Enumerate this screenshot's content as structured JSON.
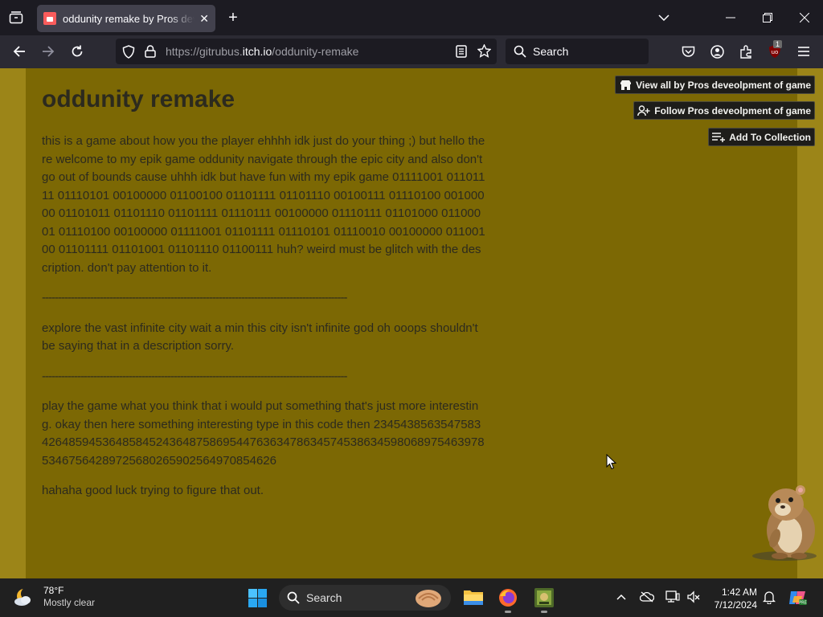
{
  "browser": {
    "tab_title": "oddunity remake by Pros deveolpment of game",
    "url_prefix": "https://gitrubus.",
    "url_domain": "itch.io",
    "url_path": "/oddunity-remake",
    "search_placeholder": "Search",
    "extension_badge": "1"
  },
  "page": {
    "title": "oddunity remake",
    "paragraphs": [
      "this is a game about how you the player ehhhh idk just do your thing ;) but hello there welcome to my epik game oddunity navigate through the epic city and also don't go out of bounds cause uhhh idk but have fun with my epik game 01111001 01101111 01110101 00100000 01100100 01101111 01101110 00100111 01110100 00100000 01101011 01101110 01101111 01110111 00100000 01110111 01101000 01100001 01110100 00100000 01111001 01101111 01110101 01110010 00100000 01100100 01101111 01101001 01101110 01100111 huh? weird must be glitch with the description. don't pay attention to it.",
      "-----------------------------------------------------------------------------------------------",
      "explore the vast infinite city wait a min this city isn't infinite god oh ooops shouldn't be saying that in a description sorry.",
      "-----------------------------------------------------------------------------------------------",
      "play the game what you think that i would put something that's just more interesting. okay then here something interesting type in this code then 23454385635475834264859453648584524364875869544763634786345745386345980689754639785346756428972568026590256497085462​6",
      "hahaha good luck trying to figure that out."
    ],
    "buttons": {
      "view_all": "View all by Pros deveolpment of game",
      "follow": "Follow Pros deveolpment of game",
      "collection": "Add To Collection"
    }
  },
  "taskbar": {
    "temperature": "78°F",
    "condition": "Mostly clear",
    "search_label": "Search",
    "time": "1:42 AM",
    "date": "7/12/2024"
  },
  "colors": {
    "page_bg": "#9c8518",
    "inner_bg": "#7c6804",
    "text": "#2c2a1e"
  }
}
